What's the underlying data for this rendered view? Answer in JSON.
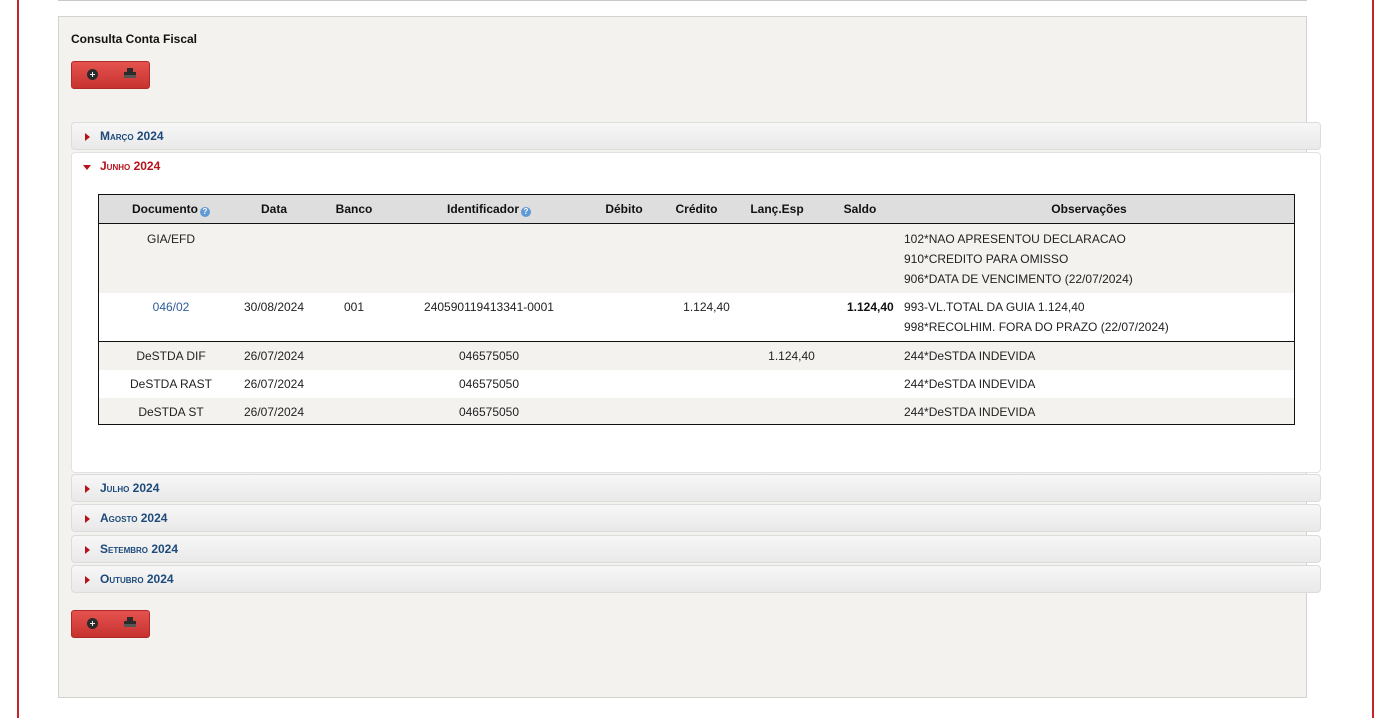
{
  "page": {
    "title": "Consulta Conta Fiscal"
  },
  "toolbar": {
    "add_icon": "plus-circle-icon",
    "print_icon": "printer-icon"
  },
  "months": [
    {
      "label": "Março 2024"
    },
    {
      "label": "Junho 2024"
    },
    {
      "label": "Julho 2024"
    },
    {
      "label": "Agosto 2024"
    },
    {
      "label": "Setembro 2024"
    },
    {
      "label": "Outubro 2024"
    }
  ],
  "table": {
    "headers": [
      "Documento",
      "Data",
      "Banco",
      "Identificador",
      "Débito",
      "Crédito",
      "Lanç.Esp",
      "Saldo",
      "Observações"
    ],
    "help_icon": "?",
    "rows": [
      {
        "doc": "GIA/EFD",
        "data": "",
        "banco": "",
        "ident": "",
        "debito": "",
        "credito": "",
        "lanc": "",
        "saldo": "",
        "obs": [
          "102*NAO APRESENTOU DECLARACAO",
          "910*CREDITO PARA OMISSO",
          "906*DATA DE VENCIMENTO (22/07/2024)"
        ]
      },
      {
        "doc": "046/02",
        "data": "30/08/2024",
        "banco": "001",
        "ident": "240590119413341-0001",
        "debito": "",
        "credito": "1.124,40",
        "lanc": "",
        "saldo": "1.124,40",
        "obs": [
          "993-VL.TOTAL DA GUIA 1.124,40",
          "998*RECOLHIM. FORA DO PRAZO (22/07/2024)"
        ]
      },
      {
        "doc": "DeSTDA DIF",
        "data": "26/07/2024",
        "banco": "",
        "ident": "046575050",
        "debito": "",
        "credito": "",
        "lanc": "1.124,40",
        "saldo": "",
        "obs": [
          "244*DeSTDA INDEVIDA"
        ]
      },
      {
        "doc": "DeSTDA RAST",
        "data": "26/07/2024",
        "banco": "",
        "ident": "046575050",
        "debito": "",
        "credito": "",
        "lanc": "",
        "saldo": "",
        "obs": [
          "244*DeSTDA INDEVIDA"
        ]
      },
      {
        "doc": "DeSTDA ST",
        "data": "26/07/2024",
        "banco": "",
        "ident": "046575050",
        "debito": "",
        "credito": "",
        "lanc": "",
        "saldo": "",
        "obs": [
          "244*DeSTDA INDEVIDA"
        ]
      }
    ]
  },
  "colors": {
    "accent_red": "#c8232c",
    "link_blue": "#2e5d9a",
    "month_blue": "#1d4a7a"
  }
}
